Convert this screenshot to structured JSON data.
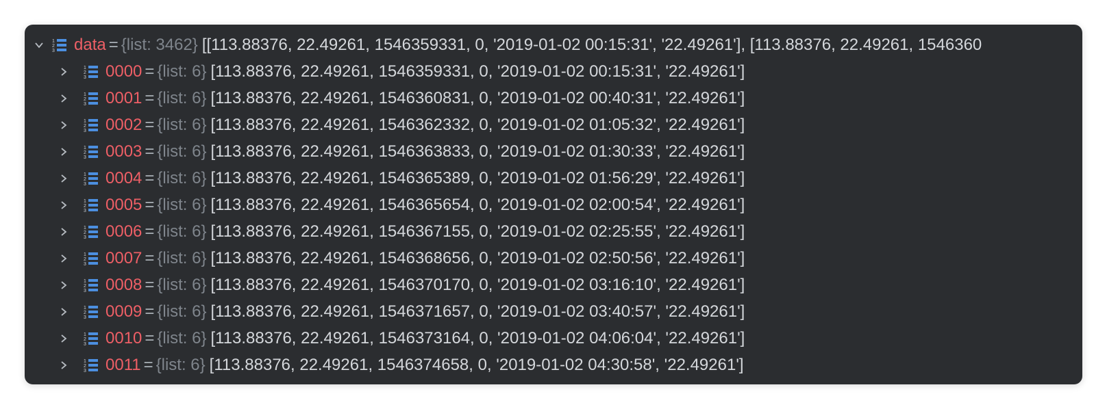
{
  "colors": {
    "panel_bg": "#2b2d30",
    "name": "#ee5f66",
    "type": "#7f858c",
    "value": "#d4d7db",
    "icon": "#4c8fe0"
  },
  "root": {
    "name": "data",
    "eq": "=",
    "type": "{list: 3462}",
    "value": "[[113.88376, 22.49261, 1546359331, 0, '2019-01-02 00:15:31', '22.49261'], [113.88376, 22.49261, 1546360",
    "expanded": true,
    "icon": "list-icon"
  },
  "items": [
    {
      "name": "0000",
      "type": "{list: 6}",
      "value": "[113.88376, 22.49261, 1546359331, 0, '2019-01-02 00:15:31', '22.49261']"
    },
    {
      "name": "0001",
      "type": "{list: 6}",
      "value": "[113.88376, 22.49261, 1546360831, 0, '2019-01-02 00:40:31', '22.49261']"
    },
    {
      "name": "0002",
      "type": "{list: 6}",
      "value": "[113.88376, 22.49261, 1546362332, 0, '2019-01-02 01:05:32', '22.49261']"
    },
    {
      "name": "0003",
      "type": "{list: 6}",
      "value": "[113.88376, 22.49261, 1546363833, 0, '2019-01-02 01:30:33', '22.49261']"
    },
    {
      "name": "0004",
      "type": "{list: 6}",
      "value": "[113.88376, 22.49261, 1546365389, 0, '2019-01-02 01:56:29', '22.49261']"
    },
    {
      "name": "0005",
      "type": "{list: 6}",
      "value": "[113.88376, 22.49261, 1546365654, 0, '2019-01-02 02:00:54', '22.49261']"
    },
    {
      "name": "0006",
      "type": "{list: 6}",
      "value": "[113.88376, 22.49261, 1546367155, 0, '2019-01-02 02:25:55', '22.49261']"
    },
    {
      "name": "0007",
      "type": "{list: 6}",
      "value": "[113.88376, 22.49261, 1546368656, 0, '2019-01-02 02:50:56', '22.49261']"
    },
    {
      "name": "0008",
      "type": "{list: 6}",
      "value": "[113.88376, 22.49261, 1546370170, 0, '2019-01-02 03:16:10', '22.49261']"
    },
    {
      "name": "0009",
      "type": "{list: 6}",
      "value": "[113.88376, 22.49261, 1546371657, 0, '2019-01-02 03:40:57', '22.49261']"
    },
    {
      "name": "0010",
      "type": "{list: 6}",
      "value": "[113.88376, 22.49261, 1546373164, 0, '2019-01-02 04:06:04', '22.49261']"
    },
    {
      "name": "0011",
      "type": "{list: 6}",
      "value": "[113.88376, 22.49261, 1546374658, 0, '2019-01-02 04:30:58', '22.49261']"
    }
  ]
}
